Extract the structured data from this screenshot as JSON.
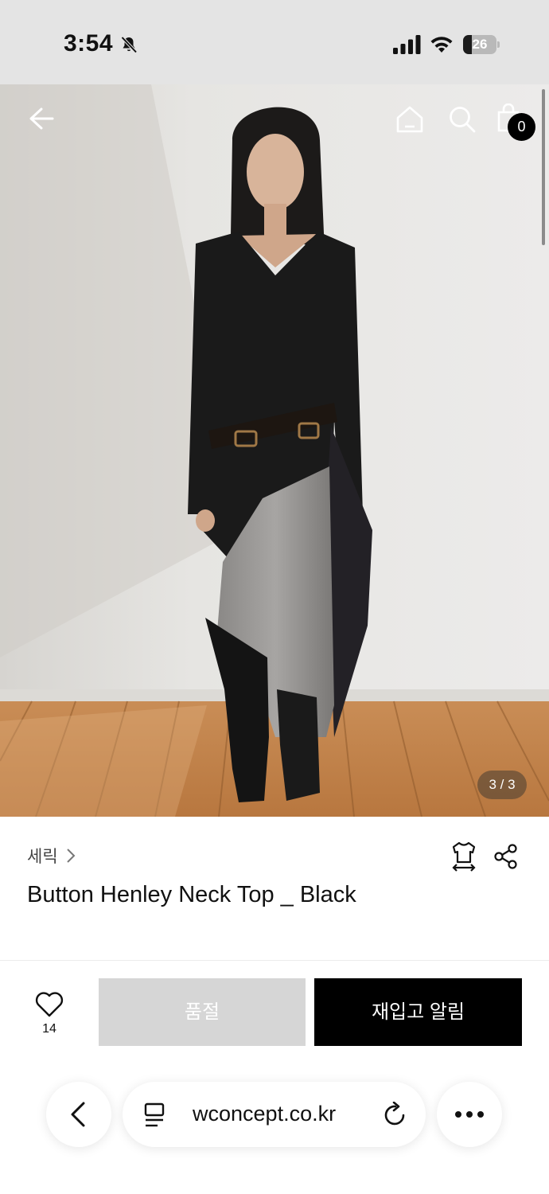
{
  "status_bar": {
    "time": "3:54",
    "battery_level": "26",
    "icons": [
      "bell-muted-icon",
      "cellular-signal-icon",
      "wifi-icon",
      "battery-icon"
    ]
  },
  "header": {
    "icons": [
      "back-arrow-icon",
      "home-icon",
      "search-icon",
      "shopping-bag-icon"
    ],
    "cart_count": "0"
  },
  "gallery": {
    "counter": "3 / 3",
    "current_index": 3,
    "total": 3
  },
  "product": {
    "brand": "세릭",
    "name": "Button Henley Neck Top _ Black",
    "icons": [
      "size-guide-icon",
      "share-icon"
    ]
  },
  "actions": {
    "like_count": "14",
    "soldout_label": "품절",
    "restock_label": "재입고 알림"
  },
  "browser": {
    "url": "wconcept.co.kr",
    "icons": [
      "browser-back-icon",
      "page-menu-icon",
      "reload-icon",
      "more-icon"
    ]
  },
  "colors": {
    "primary_button": "#000000",
    "disabled_button": "#d6d6d6",
    "status_bar_bg": "#e4e4e4"
  }
}
